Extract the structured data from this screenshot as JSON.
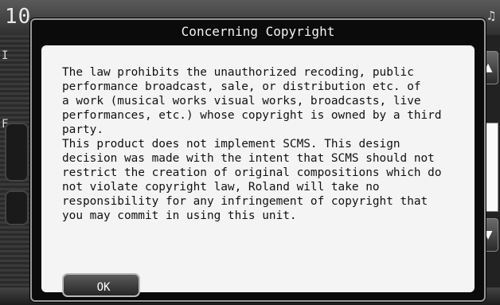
{
  "background": {
    "header_text": "10",
    "note_icon": "music-note-icon",
    "left_labels": [
      "I",
      "F"
    ]
  },
  "dialog": {
    "title": "Concerning Copyright",
    "body": "The law prohibits the unauthorized recoding, public\nperformance broadcast, sale, or distribution etc. of\na work (musical works visual works, broadcasts, live\nperformances, etc.) whose copyright is owned by a third\nparty.\nThis product does not implement SCMS. This design\ndecision was made with the intent that SCMS should not\nrestrict the creation of original compositions which do\nnot violate copyright law, Roland will take no\nresponsibility for any infringement of copyright that\nyou may commit in using this unit.",
    "ok_label": "OK"
  },
  "scroll": {
    "up_icon": "arrow-up-icon",
    "down_icon": "arrow-down-icon"
  },
  "colors": {
    "dialog_bg": "#0b0b0b",
    "body_bg": "#f4f4f4",
    "text": "#111111"
  }
}
